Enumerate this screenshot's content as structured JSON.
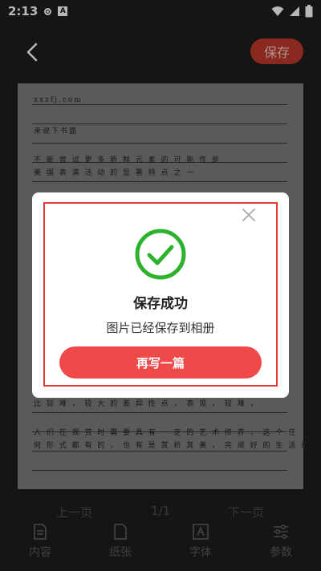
{
  "status_bar": {
    "time": "2:13",
    "a_label": "A"
  },
  "header": {
    "save_label": "保存"
  },
  "paper": {
    "lines": [
      "xxzfj.com",
      "来说下书面",
      "不 断 尝 试 更 多 新 鲜 元 素 的 可 能 性 是",
      "美 国 表 演 活 动 的 显 著 特 点 之 一",
      "比 较 难 ， 较 大 的 差 异 性 点 ， 表 现 ， 较 难 ，",
      "人 们 在 观 赏 时 需 要 具 有 一 定 的 艺 术 修 养 ， 这 个 任",
      "何 形 式 都 有 的 ， 也 有 是 赏 析 其 美 ， 完 成 好 的 生 活 而 定 ."
    ]
  },
  "pager": {
    "prev": "上一页",
    "indicator": "1/1",
    "next": "下一页"
  },
  "tabs": [
    {
      "label": "内容",
      "icon": "document-icon"
    },
    {
      "label": "纸张",
      "icon": "paper-icon"
    },
    {
      "label": "字体",
      "icon": "font-icon"
    },
    {
      "label": "参数",
      "icon": "sliders-icon"
    }
  ],
  "dialog": {
    "title": "保存成功",
    "message": "图片已经保存到相册",
    "button_label": "再写一篇"
  },
  "colors": {
    "accent": "#ef4a4a",
    "success": "#2db22d",
    "frame": "#e53935"
  }
}
